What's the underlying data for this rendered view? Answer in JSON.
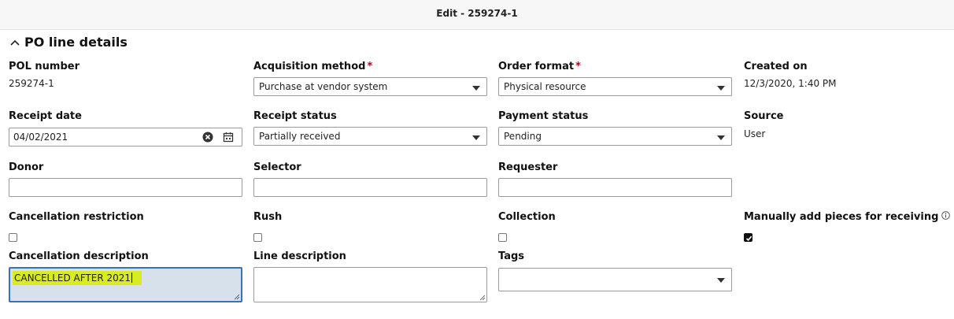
{
  "window": {
    "title": "Edit - 259274-1"
  },
  "section": {
    "title": "PO line details"
  },
  "fields": {
    "pol_number": {
      "label": "POL number",
      "value": "259274-1"
    },
    "acquisition_method": {
      "label": "Acquisition method",
      "required": "*",
      "value": "Purchase at vendor system"
    },
    "order_format": {
      "label": "Order format",
      "required": "*",
      "value": "Physical resource"
    },
    "created_on": {
      "label": "Created on",
      "value": "12/3/2020, 1:40 PM"
    },
    "receipt_date": {
      "label": "Receipt date",
      "value": "04/02/2021"
    },
    "receipt_status": {
      "label": "Receipt status",
      "value": "Partially received"
    },
    "payment_status": {
      "label": "Payment status",
      "value": "Pending"
    },
    "source": {
      "label": "Source",
      "value": "User"
    },
    "donor": {
      "label": "Donor",
      "value": ""
    },
    "selector": {
      "label": "Selector",
      "value": ""
    },
    "requester": {
      "label": "Requester",
      "value": ""
    },
    "cancellation_restriction": {
      "label": "Cancellation restriction",
      "checked": false
    },
    "rush": {
      "label": "Rush",
      "checked": false
    },
    "collection": {
      "label": "Collection",
      "checked": false
    },
    "manually_add_pieces": {
      "label": "Manually add pieces for receiving",
      "checked": true
    },
    "cancellation_description": {
      "label": "Cancellation description",
      "value": "CANCELLED AFTER 2021"
    },
    "line_description": {
      "label": "Line description",
      "value": ""
    },
    "tags": {
      "label": "Tags",
      "value": ""
    }
  },
  "colors": {
    "required_marker": "#a8001f",
    "focus_border": "#3a72b5",
    "focus_bg": "#d6e1ec",
    "text_highlight": "#d9ec22"
  },
  "icons": {
    "collapse": "chevron-up-icon",
    "clear": "clear-icon",
    "calendar": "calendar-icon",
    "info": "info-icon",
    "dropdown": "caret-down-icon"
  }
}
